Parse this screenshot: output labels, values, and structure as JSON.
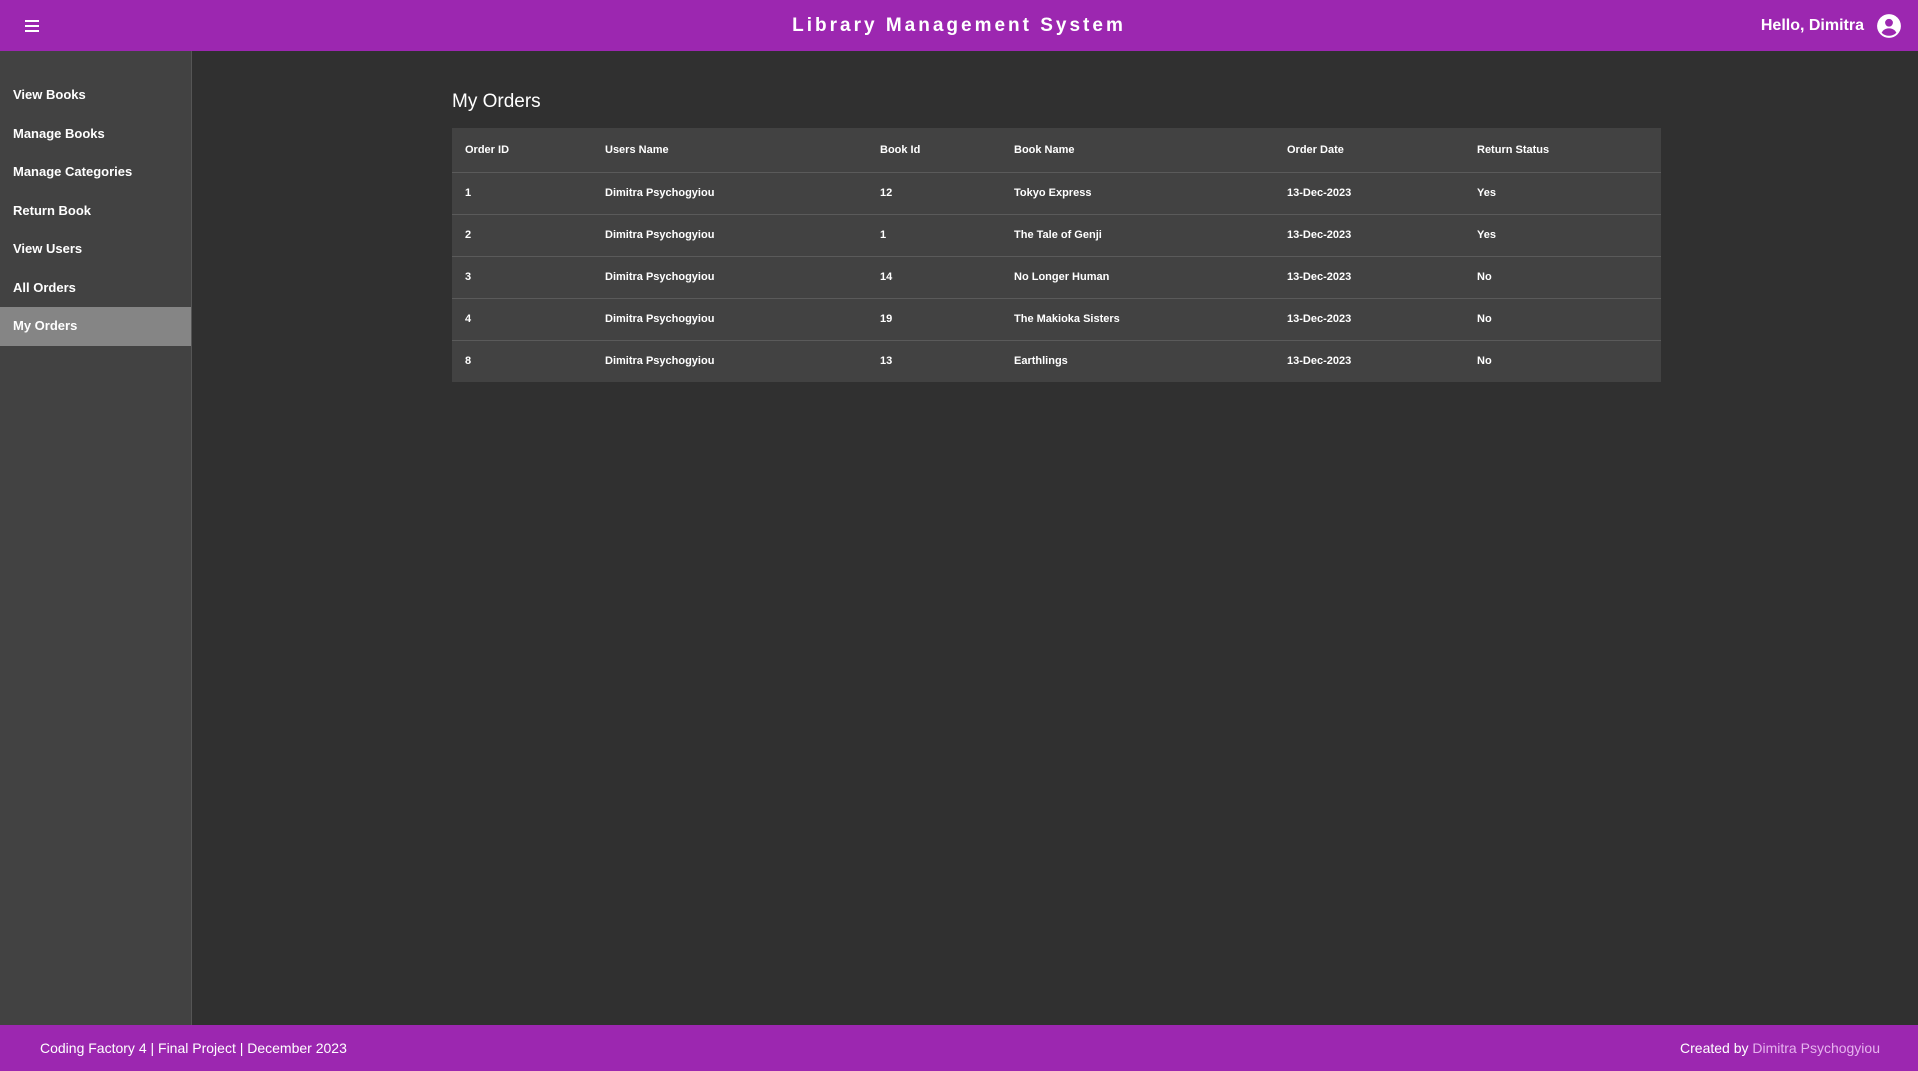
{
  "header": {
    "title": "Library Management System",
    "greeting": "Hello, Dimitra"
  },
  "sidebar": {
    "items": [
      {
        "label": "View Books"
      },
      {
        "label": "Manage Books"
      },
      {
        "label": "Manage Categories"
      },
      {
        "label": "Return Book"
      },
      {
        "label": "View Users"
      },
      {
        "label": "All Orders"
      },
      {
        "label": "My Orders",
        "active": true
      }
    ]
  },
  "main": {
    "title": "My Orders",
    "table": {
      "columns": [
        "Order ID",
        "Users Name",
        "Book Id",
        "Book Name",
        "Order Date",
        "Return Status"
      ],
      "rows": [
        [
          "1",
          "Dimitra Psychogyiou",
          "12",
          "Tokyo Express",
          "13-Dec-2023",
          "Yes"
        ],
        [
          "2",
          "Dimitra Psychogyiou",
          "1",
          "The Tale of Genji",
          "13-Dec-2023",
          "Yes"
        ],
        [
          "3",
          "Dimitra Psychogyiou",
          "14",
          "No Longer Human",
          "13-Dec-2023",
          "No"
        ],
        [
          "4",
          "Dimitra Psychogyiou",
          "19",
          "The Makioka Sisters",
          "13-Dec-2023",
          "No"
        ],
        [
          "8",
          "Dimitra Psychogyiou",
          "13",
          "Earthlings",
          "13-Dec-2023",
          "No"
        ]
      ]
    }
  },
  "footer": {
    "left": "Coding Factory 4 | Final Project | December 2023",
    "created_by": "Created by",
    "author": "Dimitra Psychogyiou"
  },
  "colors": {
    "primary": "#9c27b0",
    "background": "#303030",
    "sidebar": "#424242",
    "active_item": "#858585",
    "footer_link": "#e6b3ee"
  },
  "icons": {
    "menu": "menu-icon",
    "account": "account-circle-icon"
  }
}
